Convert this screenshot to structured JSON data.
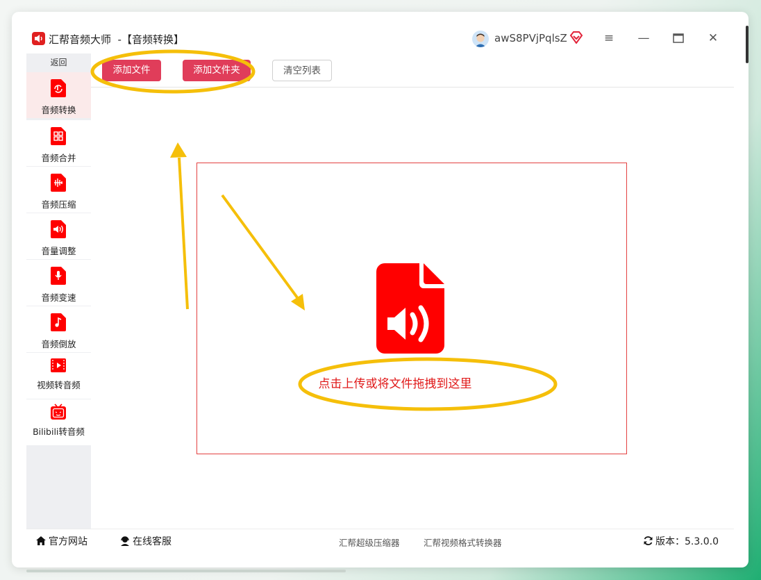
{
  "app": {
    "title": "汇帮音频大师  -【音频转换】",
    "user_name": "awS8PVjPqlsZ"
  },
  "window_controls": {
    "menu": "≡",
    "minimize": "—",
    "maximize": "□",
    "close": "✕"
  },
  "sidebar": {
    "back_label": "返回",
    "items": [
      {
        "label": "音频转换",
        "icon": "audio-convert-icon",
        "active": true
      },
      {
        "label": "音频合并",
        "icon": "audio-merge-icon"
      },
      {
        "label": "音频压缩",
        "icon": "audio-compress-icon"
      },
      {
        "label": "音量调整",
        "icon": "volume-adjust-icon"
      },
      {
        "label": "音频变速",
        "icon": "audio-speed-icon"
      },
      {
        "label": "音频倒放",
        "icon": "audio-reverse-icon"
      },
      {
        "label": "视频转音频",
        "icon": "video-to-audio-icon"
      },
      {
        "label": "Bilibili转音频",
        "icon": "bilibili-icon"
      }
    ]
  },
  "toolbar": {
    "add_file": "添加文件",
    "add_folder": "添加文件夹",
    "clear_list": "清空列表"
  },
  "dropzone": {
    "text": "点击上传或将文件拖拽到这里",
    "icon": "audio-file-icon"
  },
  "footer": {
    "website": "官方网站",
    "support": "在线客服",
    "link1": "汇帮超级压缩器",
    "link2": "汇帮视频格式转换器",
    "version": "版本：5.3.0.0"
  },
  "colors": {
    "accent_red": "#e03d5a",
    "icon_red": "#ff0000",
    "annotation_yellow": "#f5bf0a",
    "active_nav_bg": "#fbeaea"
  }
}
